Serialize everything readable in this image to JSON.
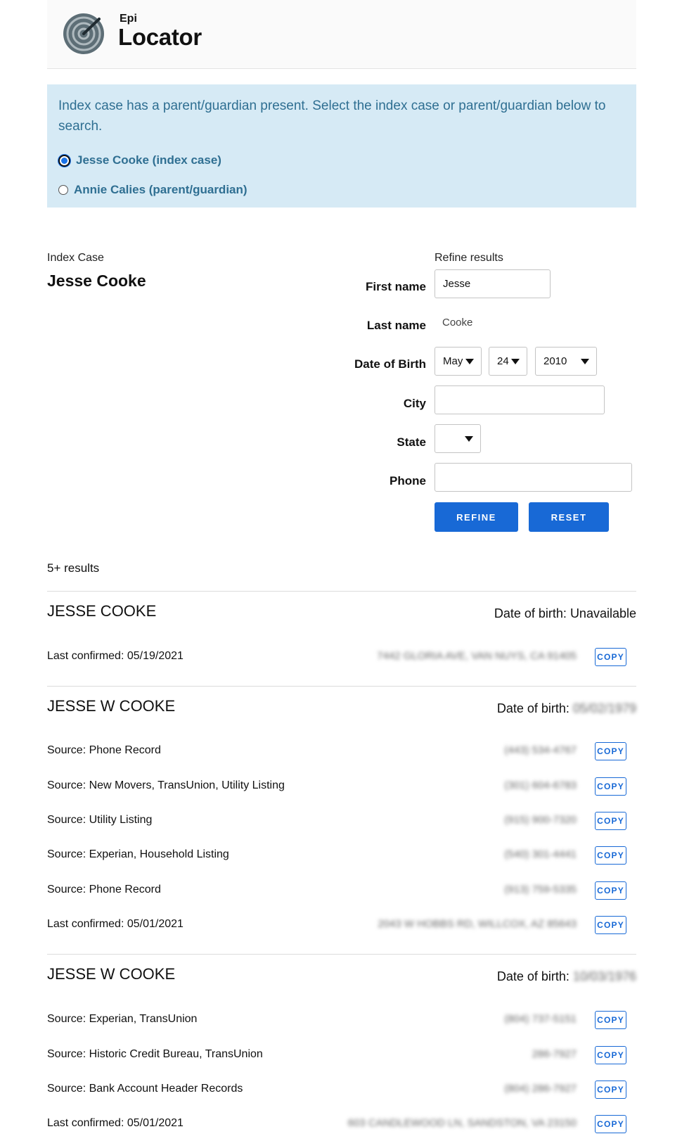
{
  "brand": {
    "sub": "Epi",
    "main": "Locator"
  },
  "notice": {
    "text": "Index case has a parent/guardian present. Select the index case or parent/guardian below to search.",
    "options": [
      {
        "label": "Jesse Cooke (index case)",
        "checked": true
      },
      {
        "label": "Annie Calies (parent/guardian)",
        "checked": false
      }
    ]
  },
  "index_case": {
    "caption": "Index Case",
    "name": "Jesse Cooke"
  },
  "refine": {
    "caption": "Refine results",
    "first_name_label": "First name",
    "first_name_value": "Jesse",
    "last_name_label": "Last name",
    "last_name_value": "Cooke",
    "dob_label": "Date of Birth",
    "dob_month": "May",
    "dob_day": "24",
    "dob_year": "2010",
    "city_label": "City",
    "city_value": "",
    "state_label": "State",
    "state_value": "",
    "phone_label": "Phone",
    "phone_value": "",
    "refine_button": "REFINE",
    "reset_button": "RESET"
  },
  "results": {
    "count": "5+ results",
    "copy_label": "COPY",
    "dob_label": "Date of birth:",
    "people": [
      {
        "name": "JESSE COOKE",
        "dob": "Unavailable",
        "dob_redacted": false,
        "records": [
          {
            "left": "Last confirmed: 05/19/2021",
            "right": "7442 GLORIA AVE, VAN NUYS, CA 91405"
          }
        ]
      },
      {
        "name": "JESSE W COOKE",
        "dob": "05/02/1979",
        "dob_redacted": true,
        "records": [
          {
            "left": "Source: Phone Record",
            "right": "(443) 534-4767"
          },
          {
            "left": "Source: New Movers, TransUnion, Utility Listing",
            "right": "(301) 604-6783"
          },
          {
            "left": "Source: Utility Listing",
            "right": "(915) 900-7320"
          },
          {
            "left": "Source: Experian, Household Listing",
            "right": "(540) 301-4441"
          },
          {
            "left": "Source: Phone Record",
            "right": "(913) 759-5335"
          },
          {
            "left": "Last confirmed: 05/01/2021",
            "right": "2043 W HOBBS RD, WILLCOX, AZ 85643"
          }
        ]
      },
      {
        "name": "JESSE W COOKE",
        "dob": "10/03/1976",
        "dob_redacted": true,
        "records": [
          {
            "left": "Source: Experian, TransUnion",
            "right": "(804) 737-5151"
          },
          {
            "left": "Source: Historic Credit Bureau, TransUnion",
            "right": "286-7927"
          },
          {
            "left": "Source: Bank Account Header Records",
            "right": "(804) 286-7927"
          },
          {
            "left": "Last confirmed: 05/01/2021",
            "right": "603 CANDLEWOOD LN, SANDSTON, VA 23150"
          }
        ]
      }
    ]
  }
}
